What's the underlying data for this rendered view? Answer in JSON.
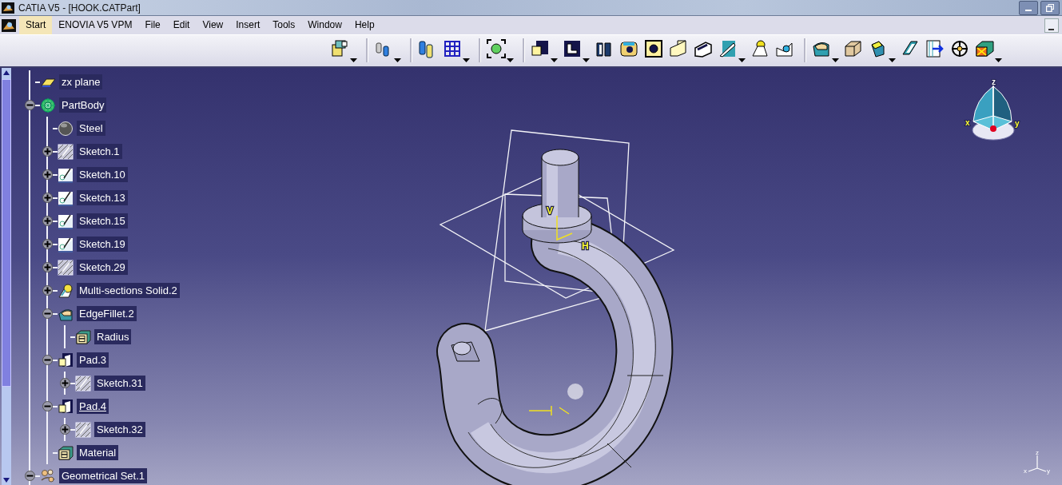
{
  "window": {
    "title": "CATIA V5 - [HOOK.CATPart]"
  },
  "menu": {
    "items": [
      {
        "label": "Start",
        "selected": true
      },
      {
        "label": "ENOVIA V5 VPM",
        "selected": false
      },
      {
        "label": "File",
        "selected": false
      },
      {
        "label": "Edit",
        "selected": false
      },
      {
        "label": "View",
        "selected": false
      },
      {
        "label": "Insert",
        "selected": false
      },
      {
        "label": "Tools",
        "selected": false
      },
      {
        "label": "Window",
        "selected": false
      },
      {
        "label": "Help",
        "selected": false
      }
    ]
  },
  "tree": {
    "items": [
      {
        "label": "zx plane",
        "kind": "plane",
        "underlined": false
      },
      {
        "label": "PartBody",
        "kind": "body",
        "underlined": false,
        "expanded": true,
        "children": [
          {
            "label": "Steel",
            "kind": "material",
            "underlined": false
          },
          {
            "label": "Sketch.1",
            "kind": "sketch-hatched",
            "underlined": false,
            "expanded": false
          },
          {
            "label": "Sketch.10",
            "kind": "sketch",
            "underlined": false,
            "expanded": false
          },
          {
            "label": "Sketch.13",
            "kind": "sketch",
            "underlined": false,
            "expanded": false
          },
          {
            "label": "Sketch.15",
            "kind": "sketch",
            "underlined": false,
            "expanded": false
          },
          {
            "label": "Sketch.19",
            "kind": "sketch",
            "underlined": false,
            "expanded": false
          },
          {
            "label": "Sketch.29",
            "kind": "sketch-hatched",
            "underlined": false,
            "expanded": false
          },
          {
            "label": "Multi-sections Solid.2",
            "kind": "solid",
            "underlined": false,
            "expanded": false
          },
          {
            "label": "EdgeFillet.2",
            "kind": "fillet",
            "underlined": false,
            "expanded": true,
            "children": [
              {
                "label": "Radius",
                "kind": "parameter",
                "underlined": false
              }
            ]
          },
          {
            "label": "Pad.3",
            "kind": "pad",
            "underlined": false,
            "expanded": true,
            "children": [
              {
                "label": "Sketch.31",
                "kind": "sketch-hatched",
                "underlined": false,
                "expanded": false
              }
            ]
          },
          {
            "label": "Pad.4",
            "kind": "pad",
            "underlined": true,
            "expanded": true,
            "children": [
              {
                "label": "Sketch.32",
                "kind": "sketch-hatched",
                "underlined": false,
                "expanded": false
              }
            ]
          },
          {
            "label": "Material",
            "kind": "parameter",
            "underlined": false
          }
        ]
      },
      {
        "label": "Geometrical Set.1",
        "kind": "geoset",
        "underlined": false,
        "expanded": true
      }
    ]
  },
  "viewport": {
    "sketch_axes": [
      "V",
      "H"
    ],
    "compass_axes": [
      "z",
      "x",
      "y"
    ],
    "corner_axes": [
      "z",
      "x",
      "y"
    ]
  }
}
